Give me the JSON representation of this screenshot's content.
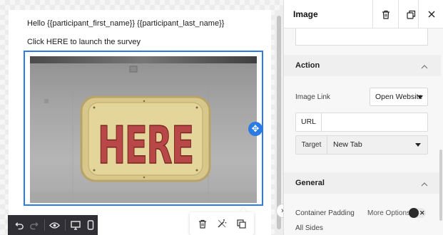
{
  "email": {
    "greeting": "Hello {{participant_first_name}} {{participant_last_name}}",
    "cta": "Click HERE to launch the survey",
    "image_sign_text": "HERE"
  },
  "panel": {
    "title": "Image",
    "sections": {
      "action": "Action",
      "general": "General"
    },
    "image_link": {
      "label": "Image Link",
      "selected": "Open Website"
    },
    "url": {
      "label": "URL",
      "value": ""
    },
    "target": {
      "label": "Target",
      "selected": "New Tab"
    },
    "container_padding": {
      "label": "Container Padding",
      "more_options": "More Options",
      "enabled": true
    },
    "all_sides": "All Sides"
  },
  "colors": {
    "accent": "#2a7be4",
    "toolbar_dark": "#2f2f35"
  }
}
